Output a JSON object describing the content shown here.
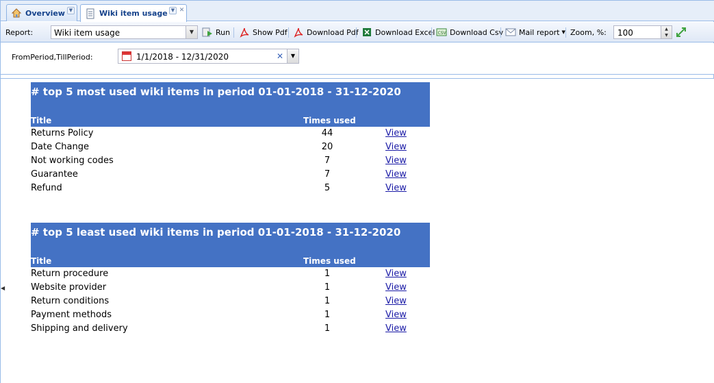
{
  "tabs": [
    {
      "label": "Overview",
      "icon": "home-icon",
      "active": false
    },
    {
      "label": "Wiki item usage",
      "icon": "notebook-icon",
      "active": true
    }
  ],
  "toolbar": {
    "report_label": "Report:",
    "report_value": "Wiki item usage",
    "run_label": "Run",
    "show_pdf_label": "Show Pdf",
    "download_pdf_label": "Download Pdf",
    "download_excel_label": "Download Excel",
    "download_csv_label": "Download Csv",
    "mail_report_label": "Mail report",
    "zoom_label": "Zoom, %:",
    "zoom_value": "100"
  },
  "params": {
    "period_label": "FromPeriod,TillPeriod:",
    "period_value": "1/1/2018 - 12/31/2020"
  },
  "report": {
    "tables": [
      {
        "title": "# top 5 most used wiki items in period 01-01-2018 - 31-12-2020",
        "col_title": "Title",
        "col_count": "Times used",
        "rows": [
          {
            "title": "Returns Policy",
            "count": "44",
            "link": "View"
          },
          {
            "title": "Date Change",
            "count": "20",
            "link": "View"
          },
          {
            "title": "Not working codes",
            "count": "7",
            "link": "View"
          },
          {
            "title": "Guarantee",
            "count": "7",
            "link": "View"
          },
          {
            "title": "Refund",
            "count": "5",
            "link": "View"
          }
        ]
      },
      {
        "title": "# top 5 least used wiki items in period 01-01-2018 - 31-12-2020",
        "col_title": "Title",
        "col_count": "Times used",
        "rows": [
          {
            "title": "Return procedure",
            "count": "1",
            "link": "View"
          },
          {
            "title": "Website provider",
            "count": "1",
            "link": "View"
          },
          {
            "title": "Return conditions",
            "count": "1",
            "link": "View"
          },
          {
            "title": "Payment methods",
            "count": "1",
            "link": "View"
          },
          {
            "title": "Shipping and delivery",
            "count": "1",
            "link": "View"
          }
        ]
      }
    ]
  },
  "colors": {
    "header_bg": "#4472c4",
    "link": "#1a1aa6",
    "tab_text": "#15428b"
  }
}
